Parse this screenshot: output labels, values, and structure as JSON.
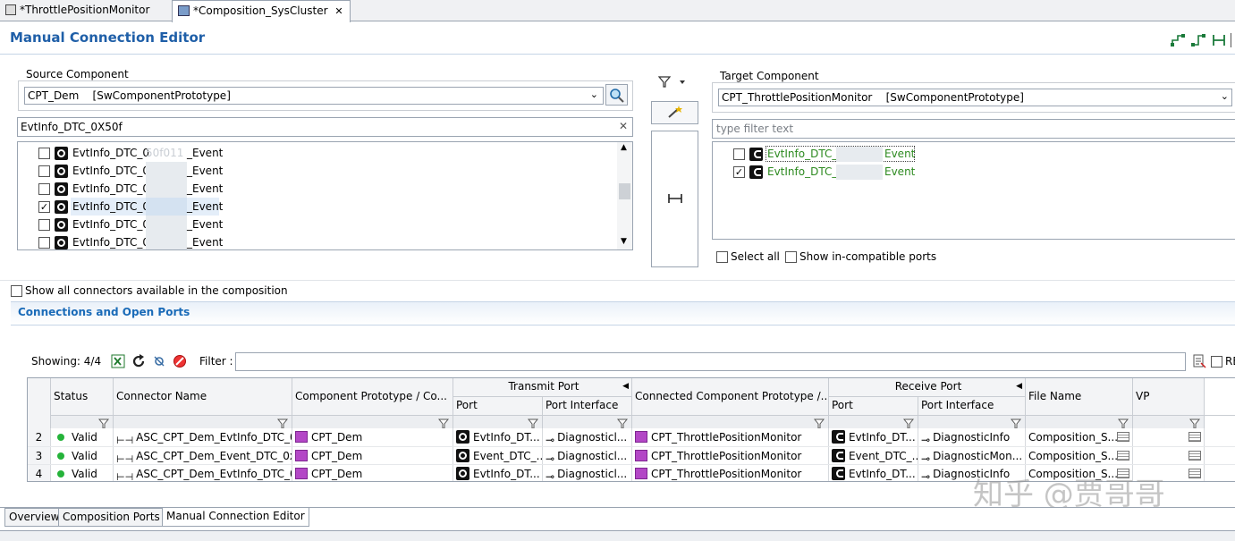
{
  "editor_tabs": [
    {
      "label": "*ThrottlePositionMonitor"
    },
    {
      "label": "*Composition_SysCluster"
    }
  ],
  "title": "Manual Connection Editor",
  "source": {
    "group_label": "Source Component",
    "selected": "CPT_Dem    [SwComponentPrototype]",
    "filter_value": "EvtInfo_DTC_0X50f",
    "ports": [
      {
        "prefix": "EvtInfo_DTC_0",
        "mid": "50f011",
        "suffix": "_Event",
        "checked": false
      },
      {
        "prefix": "EvtInfo_DTC_0",
        "mid": "",
        "suffix": "_Event",
        "checked": false
      },
      {
        "prefix": "EvtInfo_DTC_0",
        "mid": "",
        "suffix": "_Event",
        "checked": false
      },
      {
        "prefix": "EvtInfo_DTC_0",
        "mid": "",
        "suffix": "_Event",
        "checked": true
      },
      {
        "prefix": "EvtInfo_DTC_0",
        "mid": "",
        "suffix": "_Event",
        "checked": false
      },
      {
        "prefix": "EvtInfo_DTC_0",
        "mid": "",
        "suffix": "_Event",
        "checked": false
      }
    ]
  },
  "target": {
    "group_label": "Target Component",
    "selected": "CPT_ThrottlePositionMonitor    [SwComponentPrototype]",
    "filter_placeholder": "type filter text",
    "ports": [
      {
        "prefix": "EvtInfo_DTC_0",
        "suffix": "Event",
        "checked": false
      },
      {
        "prefix": "EvtInfo_DTC_0",
        "suffix": "Event",
        "checked": true
      }
    ],
    "select_all": "Select all",
    "show_incompatible": "Show in-compatible ports"
  },
  "show_all_connectors": "Show all connectors available in the composition",
  "connections": {
    "section_title": "Connections and Open Ports",
    "showing": "Showing: 4/4",
    "filter_label": "Filter :",
    "filter_value": "",
    "truncated_right": "RE",
    "headers": {
      "status": "Status",
      "connector_name": "Connector Name",
      "component_prototype": "Component Prototype / Co...",
      "transmit_port": "Transmit Port",
      "port": "Port",
      "port_interface": "Port Interface",
      "connected_component": "Connected Component Prototype /...",
      "receive_port": "Receive Port",
      "file_name": "File Name",
      "vp": "VP"
    },
    "rows": [
      {
        "num": "2",
        "status": "Valid",
        "connector": "ASC_CPT_Dem_EvtInfo_DTC_0...",
        "component": "CPT_Dem",
        "tx_port": "EvtInfo_DT...",
        "tx_iface": "Diagnosticl...",
        "connected": "CPT_ThrottlePositionMonitor",
        "rx_port": "EvtInfo_DT...",
        "rx_iface": "DiagnosticInfo",
        "file": "Composition_S..."
      },
      {
        "num": "3",
        "status": "Valid",
        "connector": "ASC_CPT_Dem_Event_DTC_0x...",
        "component": "CPT_Dem",
        "tx_port": "Event_DTC_...",
        "tx_iface": "Diagnosticl...",
        "connected": "CPT_ThrottlePositionMonitor",
        "rx_port": "Event_DTC_...",
        "rx_iface": "DiagnosticMon...",
        "file": "Composition_S..."
      },
      {
        "num": "4",
        "status": "Valid",
        "connector": "ASC_CPT_Dem_EvtInfo_DTC_0...",
        "component": "CPT_Dem",
        "tx_port": "EvtInfo_DT...",
        "tx_iface": "Diagnosticl...",
        "connected": "CPT_ThrottlePositionMonitor",
        "rx_port": "EvtInfo_DT...",
        "rx_iface": "DiagnosticInfo",
        "file": "Composition_S..."
      }
    ]
  },
  "bottom_tabs": [
    {
      "label": "Overview"
    },
    {
      "label": "Composition Ports"
    },
    {
      "label": "Manual Connection Editor"
    }
  ],
  "watermark": "知乎 @贾哥哥",
  "colors": {
    "title_blue": "#1f5fa8",
    "section_blue": "#1a6bb8",
    "green_text": "#2c8a1f",
    "valid_green": "#25b33a",
    "purple_icon": "#b347c6"
  }
}
